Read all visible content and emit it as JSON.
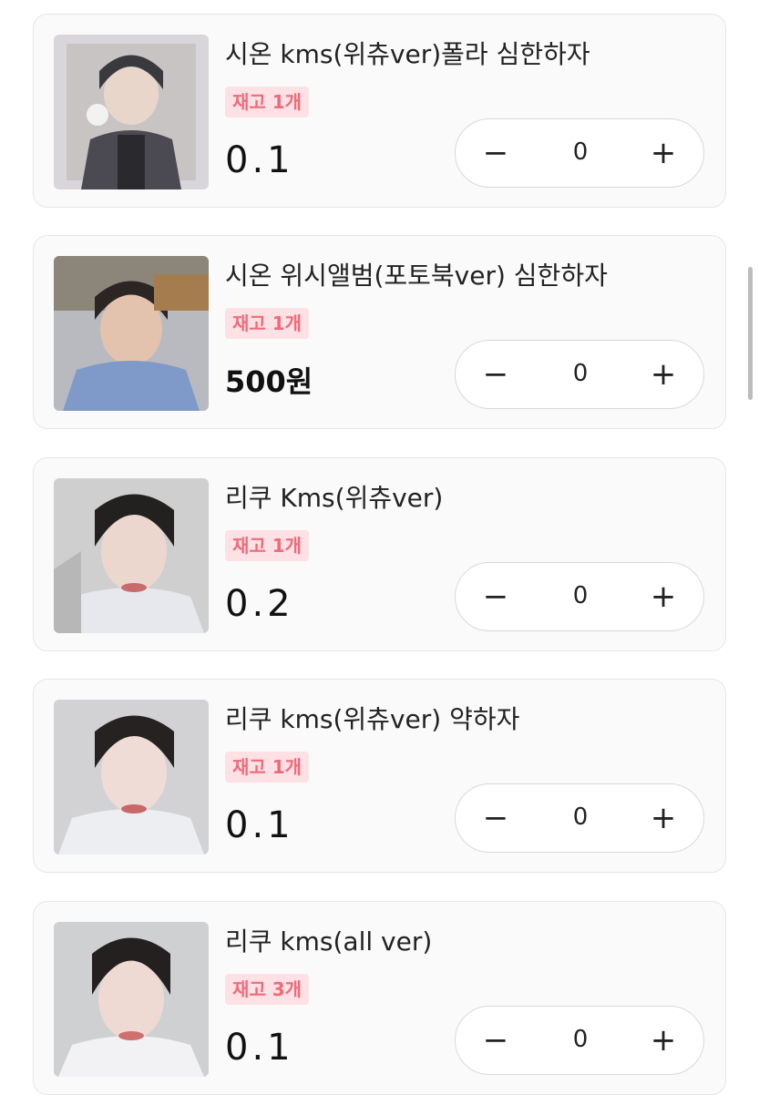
{
  "products": [
    {
      "title": "시온 kms(위츄ver)폴라 심한하자",
      "stock": "재고 1개",
      "price": "0.1",
      "quantity": "0",
      "thumb": "photo-member-a"
    },
    {
      "title": "시온 위시앨범(포토북ver) 심한하자",
      "stock": "재고 1개",
      "price": "500원",
      "quantity": "0",
      "thumb": "photo-member-a"
    },
    {
      "title": "리쿠 Kms(위츄ver)",
      "stock": "재고 1개",
      "price": "0.2",
      "quantity": "0",
      "thumb": "photo-member-b"
    },
    {
      "title": "리쿠 kms(위츄ver) 약하자",
      "stock": "재고 1개",
      "price": "0.1",
      "quantity": "0",
      "thumb": "photo-member-b"
    },
    {
      "title": "리쿠 kms(all ver)",
      "stock": "재고 3개",
      "price": "0.1",
      "quantity": "0",
      "thumb": "photo-member-b"
    }
  ],
  "stepper": {
    "minus": "−",
    "plus": "+"
  },
  "colors": {
    "badge_bg": "#fde1e4",
    "badge_text": "#f06a7a",
    "card_border": "#e6e6e6"
  }
}
